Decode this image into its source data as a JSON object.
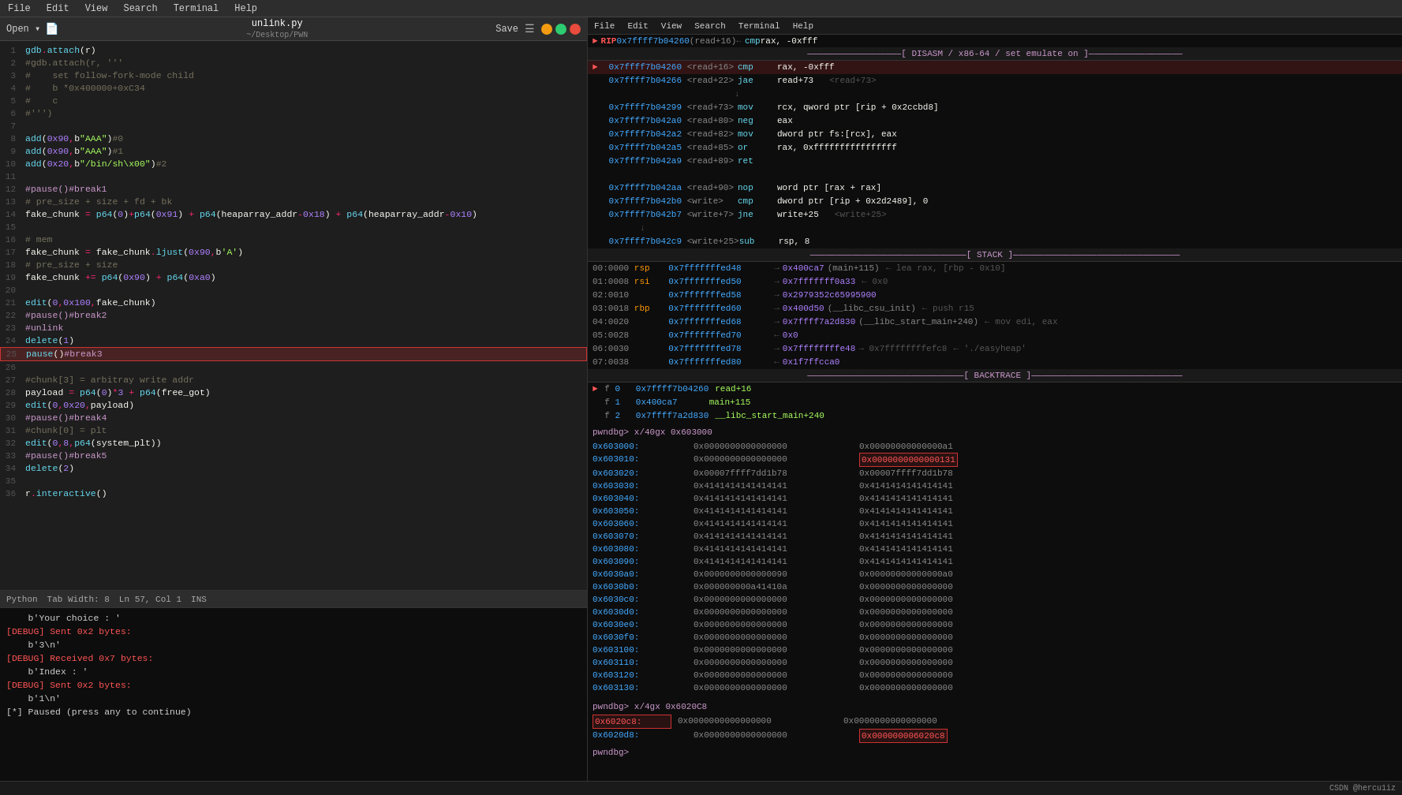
{
  "menubar": {
    "items": [
      "File",
      "Edit",
      "View",
      "Search",
      "Terminal",
      "Help"
    ]
  },
  "editor": {
    "title": "unlink.py",
    "subtitle": "~/Desktop/PWN",
    "save_label": "Save",
    "toolbar_items": [
      "Open ▾",
      "📄"
    ],
    "status": {
      "language": "Python",
      "tab_width": "Tab Width: 8",
      "position": "Ln 57, Col 1",
      "mode": "INS"
    }
  },
  "terminal": {
    "lines": [
      {
        "type": "normal",
        "text": "    b'Your choice : '"
      },
      {
        "type": "debug",
        "text": "[DEBUG] Sent 0x2 bytes:"
      },
      {
        "type": "normal",
        "text": "    b'3\\n'"
      },
      {
        "type": "debug",
        "text": "[DEBUG] Received 0x7 bytes:"
      },
      {
        "type": "normal",
        "text": "    b'Index : '"
      },
      {
        "type": "debug",
        "text": "[DEBUG] Sent 0x2 bytes:"
      },
      {
        "type": "normal",
        "text": "    b'1\\n'"
      },
      {
        "type": "normal",
        "text": "[*] Paused (press any to continue)"
      }
    ]
  },
  "debugger": {
    "menu_items": [
      "File",
      "Edit",
      "View",
      "Search",
      "Terminal",
      "Help"
    ],
    "rip": {
      "addr": "0x7ffff7b04260",
      "offset": "read+16",
      "arrow_right": "←",
      "instr": "cmp",
      "op1": "rax",
      "op2": "-0xfff"
    },
    "disasm": {
      "header": "[ DISASM / x86-64 / set emulate on ]",
      "lines": [
        {
          "arrow": "►",
          "addr": "0x7ffff7b04260",
          "offset": "<read+16>",
          "instr": "cmp",
          "operands": "rax, -0xfff",
          "comment": ""
        },
        {
          "arrow": "",
          "addr": "0x7ffff7b04266",
          "offset": "<read+22>",
          "instr": "jae",
          "operands": "read+73",
          "comment": "<read+73>"
        },
        {
          "arrow": "",
          "addr": "",
          "offset": "",
          "instr": "↓",
          "operands": "",
          "comment": ""
        },
        {
          "arrow": "",
          "addr": "0x7ffff7b04299",
          "offset": "<read+73>",
          "instr": "mov",
          "operands": "rcx, qword ptr [rip + 0x2ccbd8]",
          "comment": ""
        },
        {
          "arrow": "",
          "addr": "0x7ffff7b042a0",
          "offset": "<read+80>",
          "instr": "neg",
          "operands": "eax",
          "comment": ""
        },
        {
          "arrow": "",
          "addr": "0x7ffff7b042a2",
          "offset": "<read+82>",
          "instr": "mov",
          "operands": "dword ptr fs:[rcx], eax",
          "comment": ""
        },
        {
          "arrow": "",
          "addr": "0x7ffff7b042a5",
          "offset": "<read+85>",
          "instr": "or",
          "operands": "rax, 0xffffffffffffffff",
          "comment": ""
        },
        {
          "arrow": "",
          "addr": "0x7ffff7b042a9",
          "offset": "<read+89>",
          "instr": "ret",
          "operands": "",
          "comment": ""
        },
        {
          "arrow": "",
          "addr": "",
          "offset": "",
          "instr": "",
          "operands": "",
          "comment": ""
        },
        {
          "arrow": "",
          "addr": "0x7ffff7b042aa",
          "offset": "<read+90>",
          "instr": "nop",
          "operands": "word ptr [rax + rax]",
          "comment": ""
        },
        {
          "arrow": "",
          "addr": "0x7ffff7b042b0",
          "offset": "<write>",
          "instr": "cmp",
          "operands": "dword ptr [rip + 0x2d2489], 0",
          "comment": ""
        },
        {
          "arrow": "",
          "addr": "0x7ffff7b042b7",
          "offset": "<write+7>",
          "instr": "jne",
          "operands": "write+25",
          "comment": "<write+25>"
        },
        {
          "arrow": "",
          "addr": "",
          "offset": "↓",
          "instr": "",
          "operands": "",
          "comment": ""
        },
        {
          "arrow": "",
          "addr": "0x7ffff7b042c9",
          "offset": "<write+25>",
          "instr": "sub",
          "operands": "rsp, 8",
          "comment": ""
        }
      ]
    },
    "stack": {
      "header": "[ STACK ]",
      "lines": [
        {
          "idx": "00:0000",
          "reg": "rsp",
          "addr": "0x7fffffffed48",
          "arrow": "→",
          "val": "0x400ca7",
          "extra": "(main+115)",
          "comment": "← lea rax, [rbp - 0x10]"
        },
        {
          "idx": "01:0008",
          "reg": "rsi",
          "addr": "0x7fffffffed50",
          "arrow": "→",
          "val": "0x7fffffff0a33",
          "extra": "← 0x0",
          "comment": ""
        },
        {
          "idx": "02:0010",
          "reg": "",
          "addr": "0x7fffffffed58",
          "arrow": "→",
          "val": "0x2979352c65995900",
          "extra": "",
          "comment": ""
        },
        {
          "idx": "03:0018",
          "reg": "rbp",
          "addr": "0x7fffffffed60",
          "arrow": "→",
          "val": "0x400d50",
          "extra": "(__libc_csu_init)",
          "comment": "← push r15"
        },
        {
          "idx": "04:0020",
          "reg": "",
          "addr": "0x7fffffffed68",
          "arrow": "→",
          "val": "0x7ffff7a2d830",
          "extra": "(__libc_start_main+240)",
          "comment": "← mov edi, eax"
        },
        {
          "idx": "05:0028",
          "reg": "",
          "addr": "0x7fffffffed70",
          "arrow": "←",
          "val": "0x0",
          "extra": "",
          "comment": ""
        },
        {
          "idx": "06:0030",
          "reg": "",
          "addr": "0x7fffffffed78",
          "arrow": "→",
          "val": "0x7ffffffffe48",
          "extra": "→ 0x7ffffffffefc8",
          "comment": "← './easyheap'"
        },
        {
          "idx": "07:0038",
          "reg": "",
          "addr": "0x7fffffffed80",
          "arrow": "←",
          "val": "0x1f7ffcca0",
          "extra": "",
          "comment": ""
        }
      ]
    },
    "backtrace": {
      "header": "[ BACKTRACE ]",
      "lines": [
        {
          "arrow": "►",
          "frame": "f",
          "num": "0",
          "addr": "0x7ffff7b04260",
          "name": "read+16",
          "offset": ""
        },
        {
          "arrow": "",
          "frame": "f",
          "num": "1",
          "addr": "0x400ca7",
          "name": "main+115",
          "offset": ""
        },
        {
          "arrow": "",
          "frame": "f",
          "num": "2",
          "addr": "0x7ffff7a2d830",
          "name": "__libc_start_main+240",
          "offset": ""
        }
      ]
    },
    "memory_sections": [
      {
        "prompt": "pwndbg> x/40gx 0x603000",
        "lines": [
          {
            "addr": "0x603000:",
            "val1": "0x0000000000000000",
            "val2": "0x00000000000000a1"
          },
          {
            "addr": "0x603010:",
            "val1": "0x0000000000000000",
            "val2": "0x0000000000000131",
            "highlight2": true
          },
          {
            "addr": "0x603020:",
            "val1": "0x00007ffff7dd1b78",
            "val2": "0x00007ffff7dd1b78"
          },
          {
            "addr": "0x603030:",
            "val1": "0x4141414141414141",
            "val2": "0x4141414141414141"
          },
          {
            "addr": "0x603040:",
            "val1": "0x4141414141414141",
            "val2": "0x4141414141414141"
          },
          {
            "addr": "0x603050:",
            "val1": "0x4141414141414141",
            "val2": "0x4141414141414141"
          },
          {
            "addr": "0x603060:",
            "val1": "0x4141414141414141",
            "val2": "0x4141414141414141"
          },
          {
            "addr": "0x603070:",
            "val1": "0x4141414141414141",
            "val2": "0x4141414141414141"
          },
          {
            "addr": "0x603080:",
            "val1": "0x4141414141414141",
            "val2": "0x4141414141414141"
          },
          {
            "addr": "0x603090:",
            "val1": "0x4141414141414141",
            "val2": "0x4141414141414141"
          },
          {
            "addr": "0x6030a0:",
            "val1": "0x0000000000000090",
            "val2": "0x00000000000000a0"
          },
          {
            "addr": "0x6030b0:",
            "val1": "0x000000000a41410a",
            "val2": "0x0000000000000000"
          },
          {
            "addr": "0x6030c0:",
            "val1": "0x0000000000000000",
            "val2": "0x0000000000000000"
          },
          {
            "addr": "0x6030d0:",
            "val1": "0x0000000000000000",
            "val2": "0x0000000000000000"
          },
          {
            "addr": "0x6030e0:",
            "val1": "0x0000000000000000",
            "val2": "0x0000000000000000"
          },
          {
            "addr": "0x6030f0:",
            "val1": "0x0000000000000000",
            "val2": "0x0000000000000000"
          },
          {
            "addr": "0x603100:",
            "val1": "0x0000000000000000",
            "val2": "0x0000000000000000"
          },
          {
            "addr": "0x603110:",
            "val1": "0x0000000000000000",
            "val2": "0x0000000000000000"
          },
          {
            "addr": "0x603120:",
            "val1": "0x0000000000000000",
            "val2": "0x0000000000000000"
          },
          {
            "addr": "0x603130:",
            "val1": "0x0000000000000000",
            "val2": "0x0000000000000000"
          }
        ]
      },
      {
        "prompt": "pwndbg> x/4gx 0x6020C8",
        "lines": [
          {
            "addr": "0x6020c8:",
            "val1": "0x0000000000000000",
            "val2": "0x0000000000000000",
            "highlight_addr": true
          },
          {
            "addr": "0x6020d8:",
            "val1": "0x0000000000000000",
            "val2": "0x000000006020c8",
            "highlight2": true
          }
        ]
      }
    ],
    "final_prompt": "pwndbg>"
  },
  "statusbar": {
    "text": "CSDN @hercu1iz"
  }
}
